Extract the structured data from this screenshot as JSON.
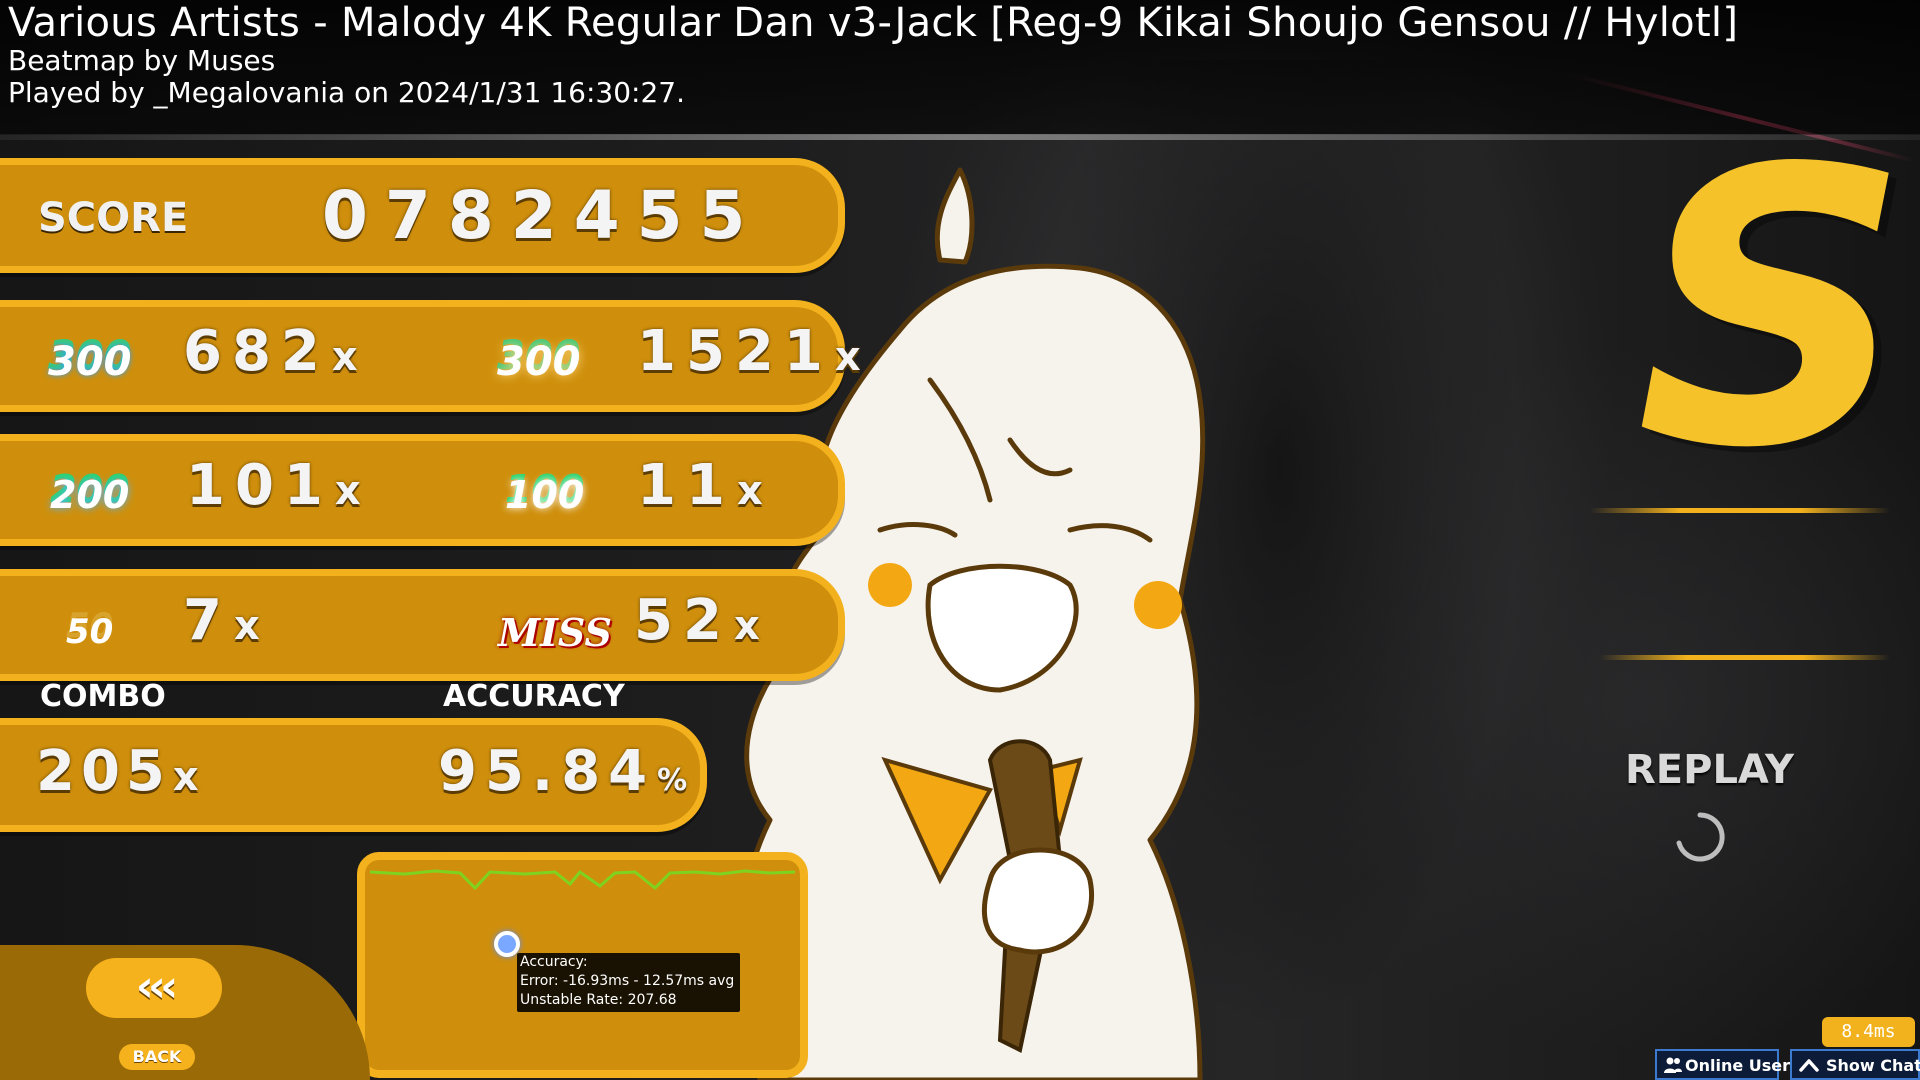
{
  "header": {
    "title": "Various Artists - Malody 4K Regular Dan v3-Jack [Reg-9 Kikai Shoujo Gensou // Hylotl]",
    "creator": "Beatmap by Muses",
    "played_by": "Played by _Megalovania on 2024/1/31 16:30:27."
  },
  "score": {
    "label": "SCORE",
    "value": "0782455"
  },
  "hits": {
    "h300": {
      "icon": "300",
      "count": "682",
      "suffix": "x"
    },
    "h300g": {
      "icon": "300",
      "count": "1521",
      "suffix": "x"
    },
    "h200": {
      "icon": "200",
      "count": "101",
      "suffix": "x"
    },
    "h100": {
      "icon": "100",
      "count": "11",
      "suffix": "x"
    },
    "h50": {
      "icon": "50",
      "count": "7",
      "suffix": "x"
    },
    "miss": {
      "icon": "MISS",
      "count": "52",
      "suffix": "x"
    }
  },
  "combo": {
    "label": "COMBO",
    "value": "205",
    "suffix": "x"
  },
  "accuracy": {
    "label": "ACCURACY",
    "value": "95.84",
    "suffix": "%"
  },
  "tooltip": {
    "line1": "Accuracy:",
    "line2": "Error: -16.93ms - 12.57ms avg",
    "line3": "Unstable Rate: 207.68"
  },
  "back": {
    "arrows": "‹‹‹",
    "label": "BACK"
  },
  "grade": "S",
  "replay": {
    "label": "REPLAY",
    "icon": "loading-spinner-icon"
  },
  "status": {
    "frametime": "8.4ms",
    "online_users": "Online Users",
    "show_chat": "Show Chat"
  },
  "colors": {
    "panel": "#cf8f0c",
    "panel_border": "#f3b21d",
    "grade": "#f5c22a",
    "graph_line": "#7ed321"
  }
}
